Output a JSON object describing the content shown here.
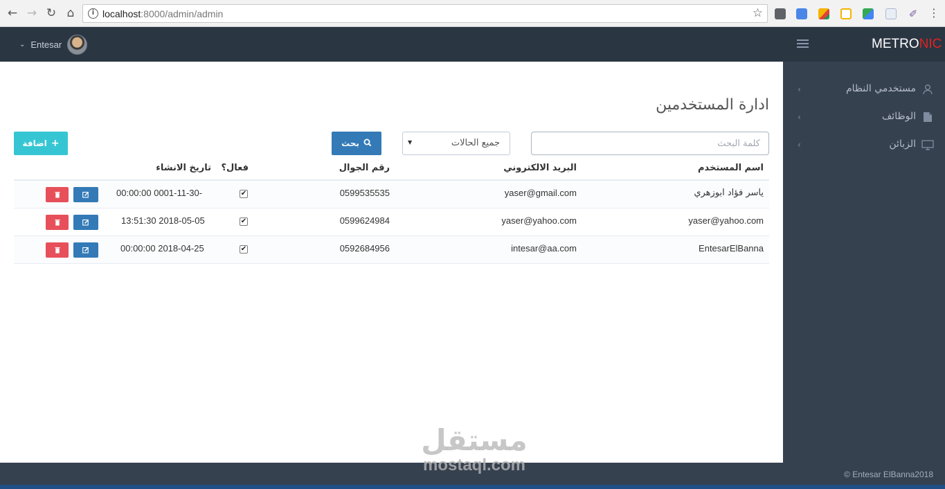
{
  "browser": {
    "url_host": "localhost",
    "url_path": ":8000/admin/admin"
  },
  "header": {
    "user_name": "Entesar",
    "logo_main": "METRO",
    "logo_accent": "NIC",
    "accent_color": "#e02222"
  },
  "sidebar": {
    "items": [
      {
        "label": "مستخدمي النظام",
        "icon": "user-icon"
      },
      {
        "label": "الوظائف",
        "icon": "document-icon"
      },
      {
        "label": "الزبائن",
        "icon": "monitor-icon"
      }
    ]
  },
  "main": {
    "title": "ادارة المستخدمين",
    "search_placeholder": "كلمة البحث",
    "status_select": "جميع الحالات",
    "search_button": "بحث",
    "add_button": "اضافة"
  },
  "table": {
    "headers": {
      "username": "اسم المستخدم",
      "email": "البريد الالكتروني",
      "mobile": "رقم الجوال",
      "active": "فعال؟",
      "created": "تاريخ الانشاء"
    },
    "rows": [
      {
        "username": "ياسر فؤاد ابوزهري",
        "email": "yaser@gmail.com",
        "mobile": "0599535535",
        "active": true,
        "created": "-0001-11-30 00:00:00"
      },
      {
        "username": "yaser@yahoo.com",
        "email": "yaser@yahoo.com",
        "mobile": "0599624984",
        "active": true,
        "created": "2018-05-05 13:51:30"
      },
      {
        "username": "EntesarElBanna",
        "email": "intesar@aa.com",
        "mobile": "0592684956",
        "active": true,
        "created": "2018-04-25 00:00:00"
      }
    ]
  },
  "footer": {
    "copyright": "© Entesar ElBanna2018"
  },
  "watermark": {
    "arabic": "مستقل",
    "latin": "mostaql.com"
  }
}
